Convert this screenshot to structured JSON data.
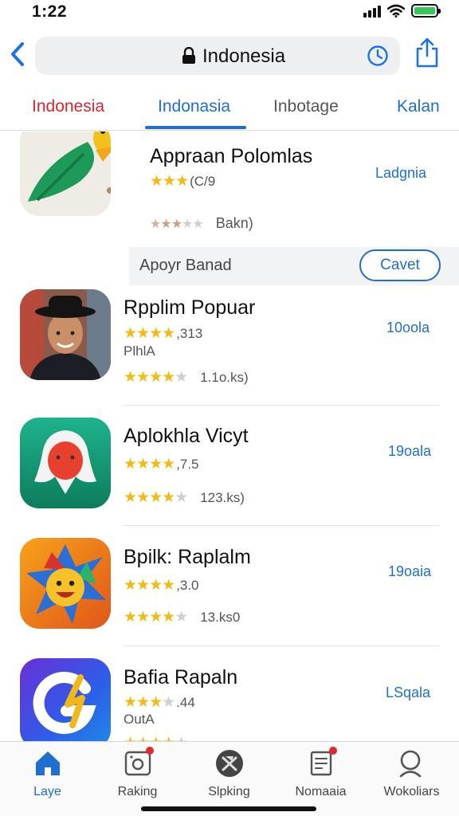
{
  "status": {
    "time": "1:22"
  },
  "browser": {
    "address": "Indonesia"
  },
  "tabs": [
    {
      "label": "Indonesia"
    },
    {
      "label": "Indonasia"
    },
    {
      "label": "Inbotage"
    },
    {
      "label": "Kalan"
    }
  ],
  "featured": {
    "name": "Appraan Polomlas",
    "rating_value": "(C/9",
    "rating_stars": 3,
    "count_stars": 3,
    "count": "Bakn)",
    "meta": "Ladgnia",
    "band_label": "Apoyr Banad",
    "get_label": "Cavet"
  },
  "apps": [
    {
      "name": "Rpplim Popuar",
      "rating_value": ",313",
      "rating_stars": 4,
      "sub": "PlhlA",
      "count_stars": 4,
      "count": "1.1o.ks)",
      "meta": "10oola"
    },
    {
      "name": "Aplokhla Vicyt",
      "rating_value": ",7.5",
      "rating_stars": 4,
      "sub": "",
      "count_stars": 4,
      "count": "123.ks)",
      "meta": "19oala"
    },
    {
      "name": "Bpilk: Raplalm",
      "rating_value": ",3.0",
      "rating_stars": 4,
      "sub": "",
      "count_stars": 4,
      "count": "13.ks0",
      "meta": "19oaia"
    },
    {
      "name": "Bafia Rapaln",
      "rating_value": ".44",
      "rating_stars": 3,
      "sub": "OutA",
      "count_stars": 4,
      "count": "",
      "meta": "LSqala"
    }
  ],
  "tabbar": [
    {
      "label": "Laye",
      "icon": "home-icon",
      "active": true
    },
    {
      "label": "Raking",
      "icon": "photo-icon",
      "active": false
    },
    {
      "label": "Slpking",
      "icon": "game-icon",
      "active": false
    },
    {
      "label": "Nomaaia",
      "icon": "book-icon",
      "active": false
    },
    {
      "label": "Wokoliars",
      "icon": "search-icon",
      "active": false
    }
  ],
  "colors": {
    "accent": "#1f6fd1",
    "tab_red": "#d7282f",
    "star": "#f5b914",
    "badge": "#e0282e"
  }
}
